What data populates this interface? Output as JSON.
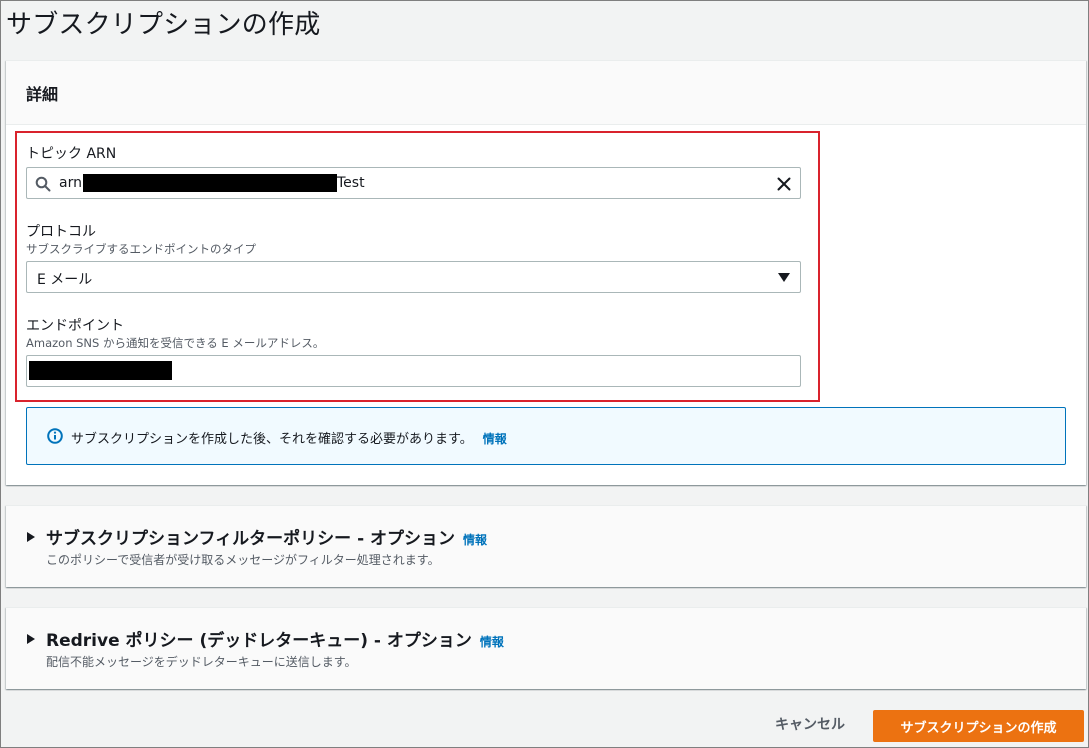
{
  "page": {
    "title": "サブスクリプションの作成"
  },
  "details": {
    "header": "詳細",
    "topic_arn": {
      "label": "トピック ARN",
      "value_prefix": "arn:",
      "value_suffix": "Test"
    },
    "protocol": {
      "label": "プロトコル",
      "description": "サブスクライブするエンドポイントのタイプ",
      "selected": "E メール"
    },
    "endpoint": {
      "label": "エンドポイント",
      "description": "Amazon SNS から通知を受信できる E メールアドレス。"
    },
    "info": {
      "text": "サブスクリプションを作成した後、それを確認する必要があります。",
      "link": "情報"
    }
  },
  "filter_policy": {
    "title": "サブスクリプションフィルターポリシー - オプション",
    "info": "情報",
    "description": "このポリシーで受信者が受け取るメッセージがフィルター処理されます。"
  },
  "redrive_policy": {
    "title": "Redrive ポリシー (デッドレターキュー) - オプション",
    "info": "情報",
    "description": "配信不能メッセージをデッドレターキューに送信します。"
  },
  "actions": {
    "cancel": "キャンセル",
    "create": "サブスクリプションの作成"
  },
  "colors": {
    "primary_button": "#ec7211",
    "link": "#0073bb",
    "highlight_border": "#d9232d",
    "info_background": "#f1faff"
  }
}
